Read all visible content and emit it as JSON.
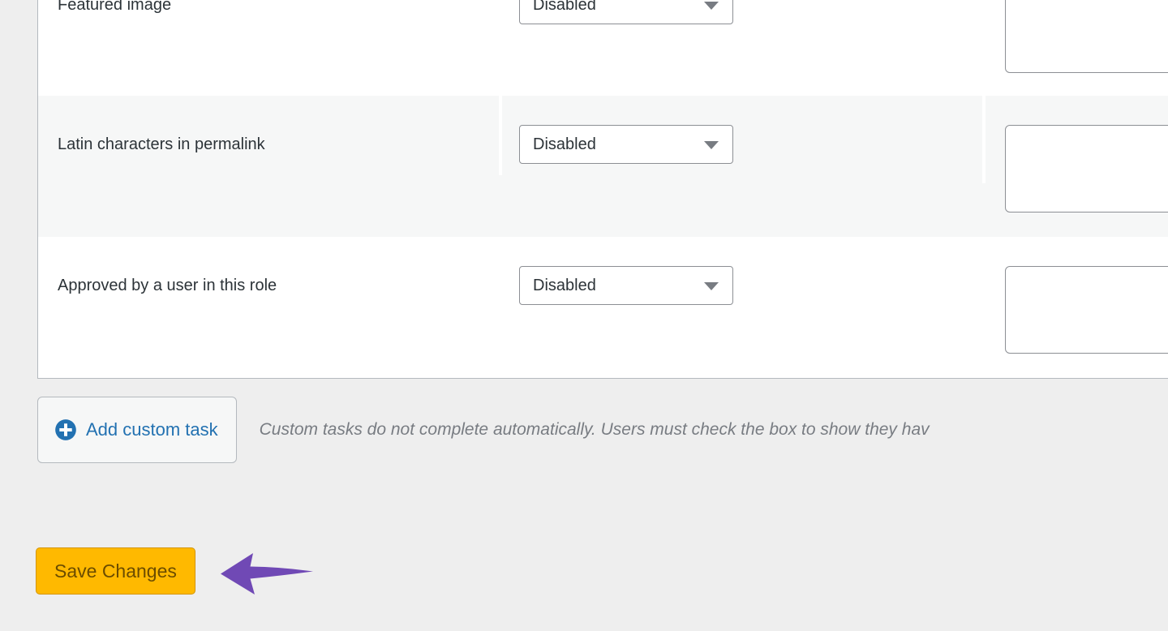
{
  "settings_table": {
    "rows": [
      {
        "label": "Featured image",
        "select_value": "Disabled",
        "note_value": "",
        "striped": false
      },
      {
        "label": "Latin characters in permalink",
        "select_value": "Disabled",
        "note_value": "",
        "striped": true
      },
      {
        "label": "Approved by a user in this role",
        "select_value": "Disabled",
        "note_value": "",
        "striped": false
      }
    ]
  },
  "actions": {
    "add_task_label": "Add custom task",
    "add_task_icon": "plus-circle-icon",
    "helper_text": "Custom tasks do not complete automatically. Users must check the box to show they hav"
  },
  "save": {
    "label": "Save Changes"
  },
  "annotation": {
    "type": "arrow-left",
    "color": "#7049b5"
  },
  "colors": {
    "accent_blue": "#2271b1",
    "save_orange": "#ffb900",
    "annotation_purple": "#7049b5",
    "page_background": "#eeeeee",
    "stripe_background": "#f6f7f7"
  }
}
